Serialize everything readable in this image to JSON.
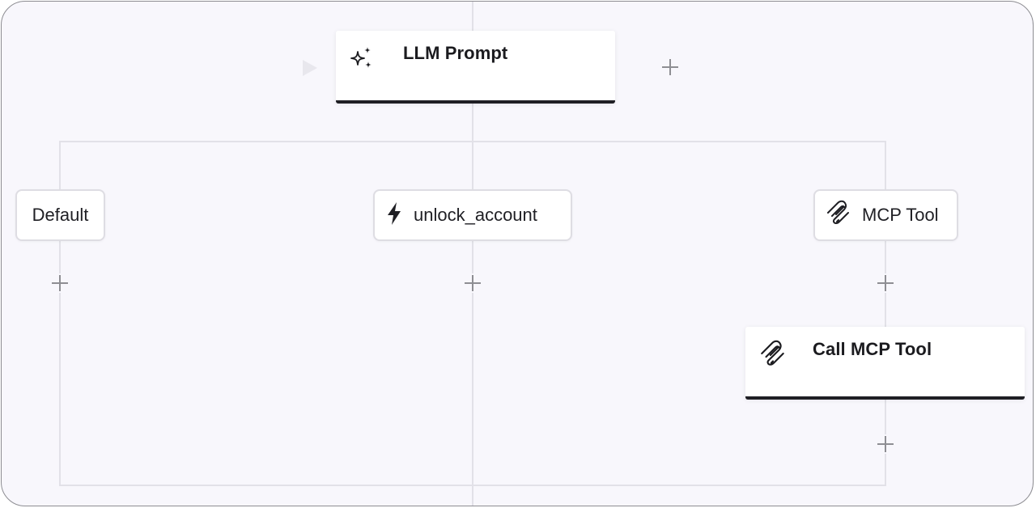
{
  "nodes": {
    "llm_prompt": {
      "title": "LLM Prompt",
      "icon": "sparkles-icon"
    },
    "call_mcp_tool": {
      "title": "Call MCP Tool",
      "icon": "paperclip-icon"
    }
  },
  "branches": {
    "default": {
      "label": "Default"
    },
    "unlock_account": {
      "label": "unlock_account",
      "icon": "lightning-icon"
    },
    "mcp_tool": {
      "label": "MCP Tool",
      "icon": "paperclip-icon"
    }
  },
  "colors": {
    "canvas_bg": "#f8f7fc",
    "connector": "#e2e1e8",
    "node_accent": "#1f1f24",
    "add_button": "#8e8e93"
  }
}
